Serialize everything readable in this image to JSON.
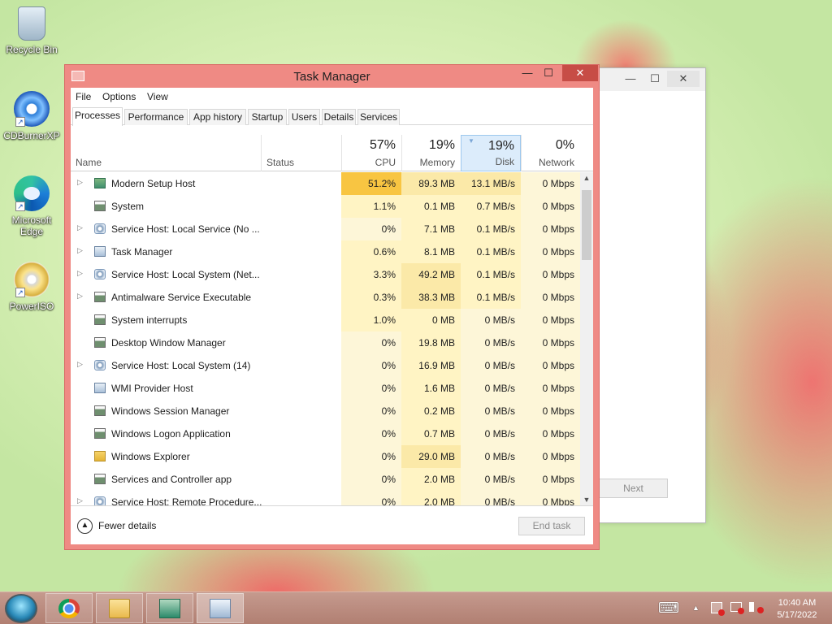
{
  "desktop": {
    "icons": [
      {
        "label": "Recycle Bin"
      },
      {
        "label": "CDBurnerXP"
      },
      {
        "label": "Microsoft Edge"
      },
      {
        "label": "PowerISO"
      }
    ]
  },
  "background_window": {
    "controls": [
      "—",
      "☐",
      "✕"
    ],
    "next_label": "Next"
  },
  "task_manager": {
    "title": "Task Manager",
    "controls": {
      "minimize": "—",
      "maximize": "☐",
      "close": "✕"
    },
    "menu": [
      "File",
      "Options",
      "View"
    ],
    "tabs": [
      "Processes",
      "Performance",
      "App history",
      "Startup",
      "Users",
      "Details",
      "Services"
    ],
    "active_tab": "Processes",
    "columns": {
      "name": "Name",
      "status": "Status",
      "cpu": {
        "pct": "57%",
        "label": "CPU"
      },
      "memory": {
        "pct": "19%",
        "label": "Memory"
      },
      "disk": {
        "pct": "19%",
        "label": "Disk"
      },
      "network": {
        "pct": "0%",
        "label": "Network"
      }
    },
    "processes": [
      {
        "name": "Modern Setup Host",
        "expandable": true,
        "icon": "setup",
        "cpu": "51.2%",
        "mem": "89.3 MB",
        "disk": "13.1 MB/s",
        "net": "0 Mbps"
      },
      {
        "name": "System",
        "expandable": false,
        "icon": "window",
        "cpu": "1.1%",
        "mem": "0.1 MB",
        "disk": "0.7 MB/s",
        "net": "0 Mbps"
      },
      {
        "name": "Service Host: Local Service (No ...",
        "expandable": true,
        "icon": "gear",
        "cpu": "0%",
        "mem": "7.1 MB",
        "disk": "0.1 MB/s",
        "net": "0 Mbps"
      },
      {
        "name": "Task Manager",
        "expandable": true,
        "icon": "taskmgr",
        "cpu": "0.6%",
        "mem": "8.1 MB",
        "disk": "0.1 MB/s",
        "net": "0 Mbps"
      },
      {
        "name": "Service Host: Local System (Net...",
        "expandable": true,
        "icon": "gear",
        "cpu": "3.3%",
        "mem": "49.2 MB",
        "disk": "0.1 MB/s",
        "net": "0 Mbps"
      },
      {
        "name": "Antimalware Service Executable",
        "expandable": true,
        "icon": "window",
        "cpu": "0.3%",
        "mem": "38.3 MB",
        "disk": "0.1 MB/s",
        "net": "0 Mbps"
      },
      {
        "name": "System interrupts",
        "expandable": false,
        "icon": "window",
        "cpu": "1.0%",
        "mem": "0 MB",
        "disk": "0 MB/s",
        "net": "0 Mbps"
      },
      {
        "name": "Desktop Window Manager",
        "expandable": false,
        "icon": "window",
        "cpu": "0%",
        "mem": "19.8 MB",
        "disk": "0 MB/s",
        "net": "0 Mbps"
      },
      {
        "name": "Service Host: Local System (14)",
        "expandable": true,
        "icon": "gear",
        "cpu": "0%",
        "mem": "16.9 MB",
        "disk": "0 MB/s",
        "net": "0 Mbps"
      },
      {
        "name": "WMI Provider Host",
        "expandable": false,
        "icon": "taskmgr",
        "cpu": "0%",
        "mem": "1.6 MB",
        "disk": "0 MB/s",
        "net": "0 Mbps"
      },
      {
        "name": "Windows Session Manager",
        "expandable": false,
        "icon": "window",
        "cpu": "0%",
        "mem": "0.2 MB",
        "disk": "0 MB/s",
        "net": "0 Mbps"
      },
      {
        "name": "Windows Logon Application",
        "expandable": false,
        "icon": "window",
        "cpu": "0%",
        "mem": "0.7 MB",
        "disk": "0 MB/s",
        "net": "0 Mbps"
      },
      {
        "name": "Windows Explorer",
        "expandable": false,
        "icon": "folder",
        "cpu": "0%",
        "mem": "29.0 MB",
        "disk": "0 MB/s",
        "net": "0 Mbps"
      },
      {
        "name": "Services and Controller app",
        "expandable": false,
        "icon": "window",
        "cpu": "0%",
        "mem": "2.0 MB",
        "disk": "0 MB/s",
        "net": "0 Mbps"
      },
      {
        "name": "Service Host: Remote Procedure...",
        "expandable": true,
        "icon": "gear",
        "cpu": "0%",
        "mem": "2.0 MB",
        "disk": "0 MB/s",
        "net": "0 Mbps"
      }
    ],
    "footer": {
      "fewer_details": "Fewer details",
      "end_task": "End task"
    },
    "heat_colors": {
      "cpu_high": "#f8c542",
      "light": "#fff4c4",
      "medium": "#fbe9a8",
      "column": "#fdf6d8"
    }
  },
  "taskbar": {
    "apps": [
      {
        "name": "chrome-icon",
        "active": false
      },
      {
        "name": "file-explorer-icon",
        "active": false
      },
      {
        "name": "setup-icon",
        "active": false
      },
      {
        "name": "task-manager-icon",
        "active": true
      }
    ],
    "tray": {
      "keyboard": "⌨",
      "up_arrow": "▲"
    },
    "time": "10:40 AM",
    "date": "5/17/2022"
  }
}
